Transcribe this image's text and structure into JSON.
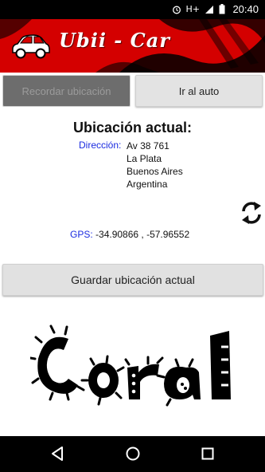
{
  "status": {
    "time": "20:40",
    "network": "H+"
  },
  "app": {
    "title": "Ubii - Car"
  },
  "tabs": {
    "left": "Recordar ubicación",
    "right": "Ir al auto"
  },
  "location": {
    "heading": "Ubicación actual:",
    "address_label": "Dirección:",
    "address_lines": [
      "Av 38 761",
      "La Plata",
      "Buenos Aires",
      "Argentina"
    ],
    "gps_label": "GPS:",
    "gps_value": "-34.90866 , -57.96552"
  },
  "save_button": "Guardar ubicación actual",
  "logo_text": "Coral",
  "icons": {
    "refresh": "refresh-icon",
    "back": "back-icon",
    "home": "home-icon",
    "recents": "recents-icon",
    "car": "car-icon"
  }
}
